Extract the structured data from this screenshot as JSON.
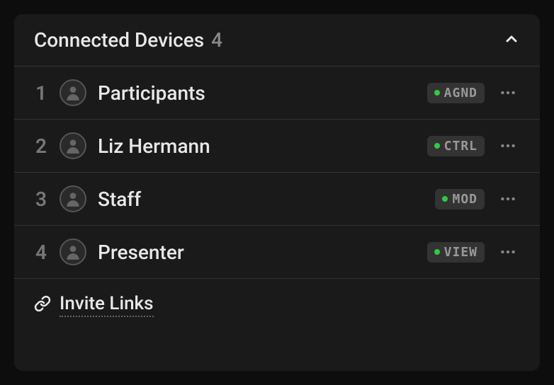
{
  "header": {
    "title": "Connected Devices",
    "count": "4"
  },
  "devices": [
    {
      "index": "1",
      "name": "Participants",
      "badge": "AGND"
    },
    {
      "index": "2",
      "name": "Liz Hermann",
      "badge": "CTRL"
    },
    {
      "index": "3",
      "name": "Staff",
      "badge": "MOD"
    },
    {
      "index": "4",
      "name": "Presenter",
      "badge": "VIEW"
    }
  ],
  "footer": {
    "label": "Invite Links"
  }
}
